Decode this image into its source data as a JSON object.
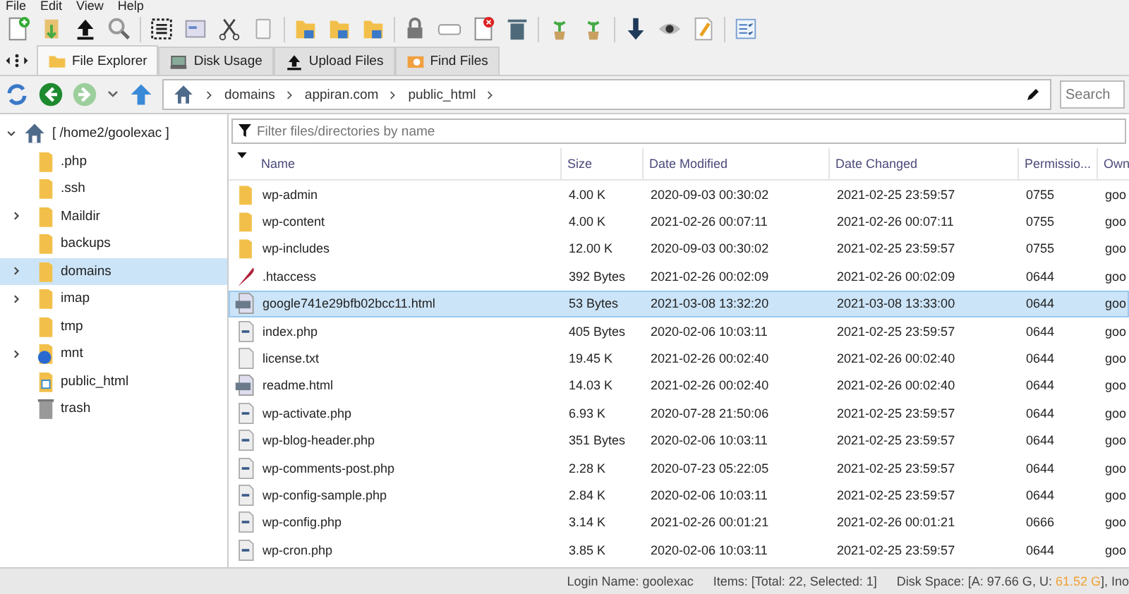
{
  "menu": [
    "File",
    "Edit",
    "View",
    "Help"
  ],
  "tabs": [
    {
      "label": "File Explorer",
      "selected": true
    },
    {
      "label": "Disk Usage",
      "selected": false
    },
    {
      "label": "Upload Files",
      "selected": false
    },
    {
      "label": "Find Files",
      "selected": false
    }
  ],
  "breadcrumb": [
    "domains",
    "appiran.com",
    "public_html"
  ],
  "search": {
    "placeholder": "Search"
  },
  "tree": {
    "label": "[ /home2/goolexac ]",
    "expanded": true,
    "children": [
      {
        "label": ".php",
        "kind": "folder",
        "expandable": false,
        "selected": false
      },
      {
        "label": ".ssh",
        "kind": "folder",
        "expandable": false,
        "selected": false
      },
      {
        "label": "Maildir",
        "kind": "folder",
        "expandable": true,
        "selected": false
      },
      {
        "label": "backups",
        "kind": "folder",
        "expandable": false,
        "selected": false
      },
      {
        "label": "domains",
        "kind": "folder",
        "expandable": true,
        "selected": true
      },
      {
        "label": "imap",
        "kind": "folder",
        "expandable": true,
        "selected": false
      },
      {
        "label": "tmp",
        "kind": "folder",
        "expandable": false,
        "selected": false
      },
      {
        "label": "mnt",
        "kind": "globe",
        "expandable": true,
        "selected": false
      },
      {
        "label": "public_html",
        "kind": "web",
        "expandable": false,
        "selected": false
      },
      {
        "label": "trash",
        "kind": "trash",
        "expandable": false,
        "selected": false
      }
    ]
  },
  "filter": {
    "placeholder": "Filter files/directories by name"
  },
  "table": {
    "columns": [
      "Name",
      "Size",
      "Date Modified",
      "Date Changed",
      "Permissio...",
      "Own"
    ],
    "rows": [
      {
        "kind": "folder",
        "selected": false,
        "cells": [
          "wp-admin",
          "4.00 K",
          "2020-09-03 00:30:02",
          "2021-02-25 23:59:57",
          "0755",
          "goo"
        ]
      },
      {
        "kind": "folder",
        "selected": false,
        "cells": [
          "wp-content",
          "4.00 K",
          "2021-02-26 00:07:11",
          "2021-02-26 00:07:11",
          "0755",
          "goo"
        ]
      },
      {
        "kind": "folder",
        "selected": false,
        "cells": [
          "wp-includes",
          "12.00 K",
          "2020-09-03 00:30:02",
          "2021-02-25 23:59:57",
          "0755",
          "goo"
        ]
      },
      {
        "kind": "feather",
        "selected": false,
        "cells": [
          ".htaccess",
          "392 Bytes",
          "2021-02-26 00:02:09",
          "2021-02-26 00:02:09",
          "0644",
          "goo"
        ]
      },
      {
        "kind": "html",
        "selected": true,
        "cells": [
          "google741e29bfb02bcc11.html",
          "53 Bytes",
          "2021-03-08 13:32:20",
          "2021-03-08 13:33:00",
          "0644",
          "goo"
        ]
      },
      {
        "kind": "php",
        "selected": false,
        "cells": [
          "index.php",
          "405 Bytes",
          "2020-02-06 10:03:11",
          "2021-02-25 23:59:57",
          "0644",
          "goo"
        ]
      },
      {
        "kind": "txt",
        "selected": false,
        "cells": [
          "license.txt",
          "19.45 K",
          "2021-02-26 00:02:40",
          "2021-02-26 00:02:40",
          "0644",
          "goo"
        ]
      },
      {
        "kind": "html",
        "selected": false,
        "cells": [
          "readme.html",
          "14.03 K",
          "2021-02-26 00:02:40",
          "2021-02-26 00:02:40",
          "0644",
          "goo"
        ]
      },
      {
        "kind": "php",
        "selected": false,
        "cells": [
          "wp-activate.php",
          "6.93 K",
          "2020-07-28 21:50:06",
          "2021-02-25 23:59:57",
          "0644",
          "goo"
        ]
      },
      {
        "kind": "php",
        "selected": false,
        "cells": [
          "wp-blog-header.php",
          "351 Bytes",
          "2020-02-06 10:03:11",
          "2021-02-25 23:59:57",
          "0644",
          "goo"
        ]
      },
      {
        "kind": "php",
        "selected": false,
        "cells": [
          "wp-comments-post.php",
          "2.28 K",
          "2020-07-23 05:22:05",
          "2021-02-25 23:59:57",
          "0644",
          "goo"
        ]
      },
      {
        "kind": "php",
        "selected": false,
        "cells": [
          "wp-config-sample.php",
          "2.84 K",
          "2020-02-06 10:03:11",
          "2021-02-25 23:59:57",
          "0644",
          "goo"
        ]
      },
      {
        "kind": "php",
        "selected": false,
        "cells": [
          "wp-config.php",
          "3.14 K",
          "2021-02-26 00:01:21",
          "2021-02-26 00:01:21",
          "0666",
          "goo"
        ]
      },
      {
        "kind": "php",
        "selected": false,
        "cells": [
          "wp-cron.php",
          "3.85 K",
          "2020-02-06 10:03:11",
          "2021-02-25 23:59:57",
          "0644",
          "goo"
        ]
      }
    ]
  },
  "status_bar": {
    "login": "Login Name: goolexac",
    "items": "Items: [Total: 22, Selected: 1]",
    "disk": {
      "prefix": "Disk Space: [A: 97.66 G, U: ",
      "used": "61.52 G",
      "suffix": "], Ino"
    }
  }
}
